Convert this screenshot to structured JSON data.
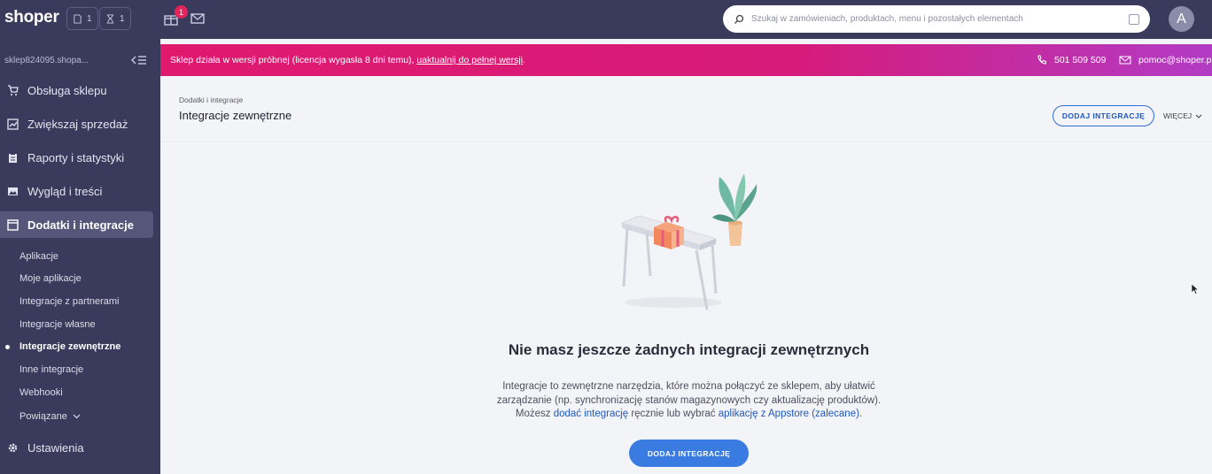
{
  "topbar": {
    "logo": "shoper",
    "orders_count": "1",
    "timer_count": "1",
    "gift_badge": "1",
    "search_placeholder": "Szukaj w zamówieniach, produktach, menu i pozostałych elementach",
    "avatar_letter": "A"
  },
  "sidebar": {
    "shop_name": "sklep824095.shopa...",
    "items": [
      {
        "label": "Obsługa sklepu",
        "icon": "cart-icon"
      },
      {
        "label": "Zwiększaj sprzedaż",
        "icon": "chart-icon"
      },
      {
        "label": "Raporty i statystyki",
        "icon": "clipboard-icon"
      },
      {
        "label": "Wygląd i treści",
        "icon": "image-icon"
      },
      {
        "label": "Dodatki i integracje",
        "icon": "window-icon"
      }
    ],
    "sub_items": [
      {
        "label": "Aplikacje"
      },
      {
        "label": "Moje aplikacje"
      },
      {
        "label": "Integracje z partnerami"
      },
      {
        "label": "Integracje własne"
      },
      {
        "label": "Integracje zewnętrzne"
      },
      {
        "label": "Inne integracje"
      },
      {
        "label": "Webhooki"
      },
      {
        "label": "Powiązane"
      }
    ],
    "settings_label": "Ustawienia"
  },
  "banner": {
    "message": "Sklep działa w wersji próbnej (licencja wygasła 8 dni temu),",
    "link": "uaktualnij do pełnej wersji",
    "tail": ".",
    "phone": "501 509 509",
    "email": "pomoc@shoper.pl"
  },
  "header": {
    "breadcrumb": "Dodatki i integracje",
    "title": "Integracje zewnętrzne",
    "add_button": "DODAJ INTEGRACJĘ",
    "more_label": "WIĘCEJ"
  },
  "empty_state": {
    "title": "Nie masz jeszcze żadnych integracji zewnętrznych",
    "line1": "Integracje to zewnętrzne narzędzia, które można połączyć ze sklepem, aby ułatwić",
    "line2": "zarządzanie (np. synchronizację stanów magazynowych czy aktualizację produktów).",
    "line3_prefix": "Możesz",
    "line3_link1": "dodać integrację",
    "line3_mid": "ręcznie lub wybrać",
    "line3_link2": "aplikację z Appstore (zalecane)",
    "line3_suffix": ".",
    "button": "DODAJ INTEGRACJĘ"
  },
  "colors": {
    "sidebar_bg": "#3a3a5c",
    "banner_start": "#e0196f",
    "banner_end": "#b23bc4",
    "accent": "#3a7be2"
  }
}
